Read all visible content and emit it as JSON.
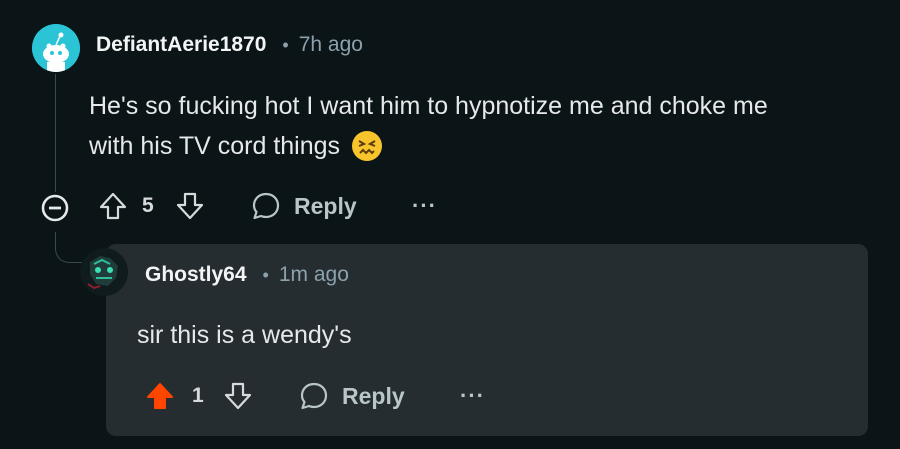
{
  "comment": {
    "username": "DefiantAerie1870",
    "separator": "•",
    "time": "7h ago",
    "text_line1": "He's so fucking hot I want him to hypnotize me and choke me",
    "text_line2": "with his TV cord things",
    "emoji": "😖",
    "vote_count": "5",
    "reply_label": "Reply",
    "more_label": "···",
    "avatar_color": "#2bc3d6"
  },
  "reply": {
    "username": "Ghostly64",
    "separator": "•",
    "time": "1m ago",
    "text": "sir this is a wendy's",
    "vote_count": "1",
    "reply_label": "Reply",
    "more_label": "···",
    "upvote_color": "#ff4500",
    "card_color": "#262d30"
  },
  "icons": {
    "collapse": "minus-circle-icon",
    "upvote": "arrow-up-icon",
    "downvote": "arrow-down-icon",
    "reply": "speech-bubble-icon",
    "more": "ellipsis-icon"
  }
}
